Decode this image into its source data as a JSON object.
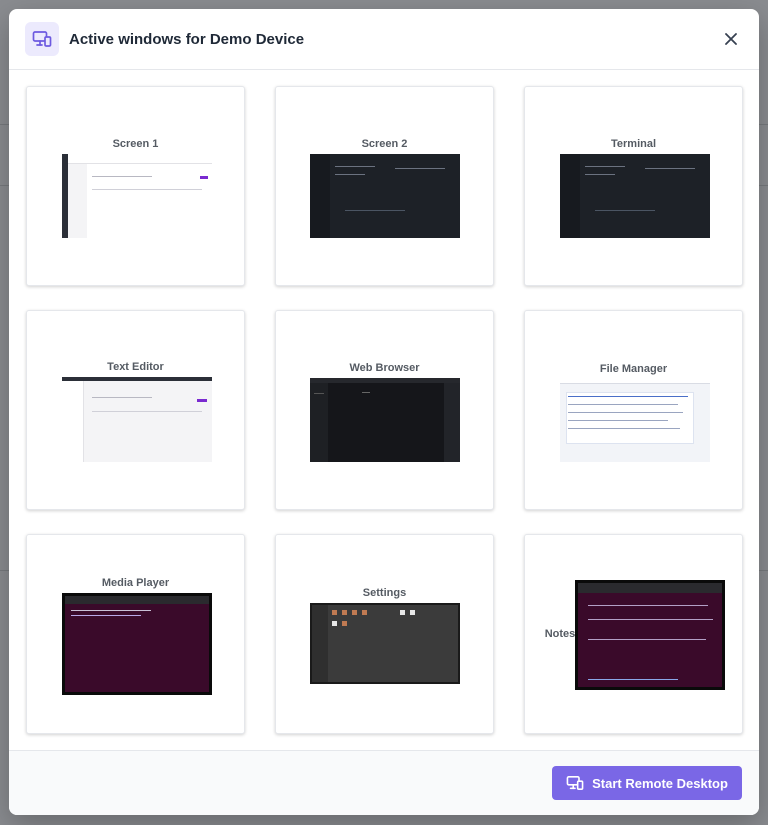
{
  "dialog": {
    "title": "Active windows for Demo Device",
    "header_icon": "devices-icon",
    "close_icon": "close-icon"
  },
  "windows": [
    {
      "label": "Screen 1",
      "thumbnail": "light-dashboard"
    },
    {
      "label": "Screen 2",
      "thumbnail": "dark-code"
    },
    {
      "label": "Terminal",
      "thumbnail": "dark-code"
    },
    {
      "label": "Text Editor",
      "thumbnail": "light-dashboard"
    },
    {
      "label": "Web Browser",
      "thumbnail": "dark-ide"
    },
    {
      "label": "File Manager",
      "thumbnail": "file-list"
    },
    {
      "label": "Media Player",
      "thumbnail": "purple-terminal"
    },
    {
      "label": "Settings",
      "thumbnail": "gray-file-grid"
    },
    {
      "label": "Notes",
      "thumbnail": "purple-terminal"
    }
  ],
  "footer": {
    "start_button": "Start Remote Desktop",
    "start_icon": "devices-icon"
  },
  "colors": {
    "accent": "#7a67e6",
    "accent_light": "#eceafd",
    "overlay": "#7d7f83"
  }
}
